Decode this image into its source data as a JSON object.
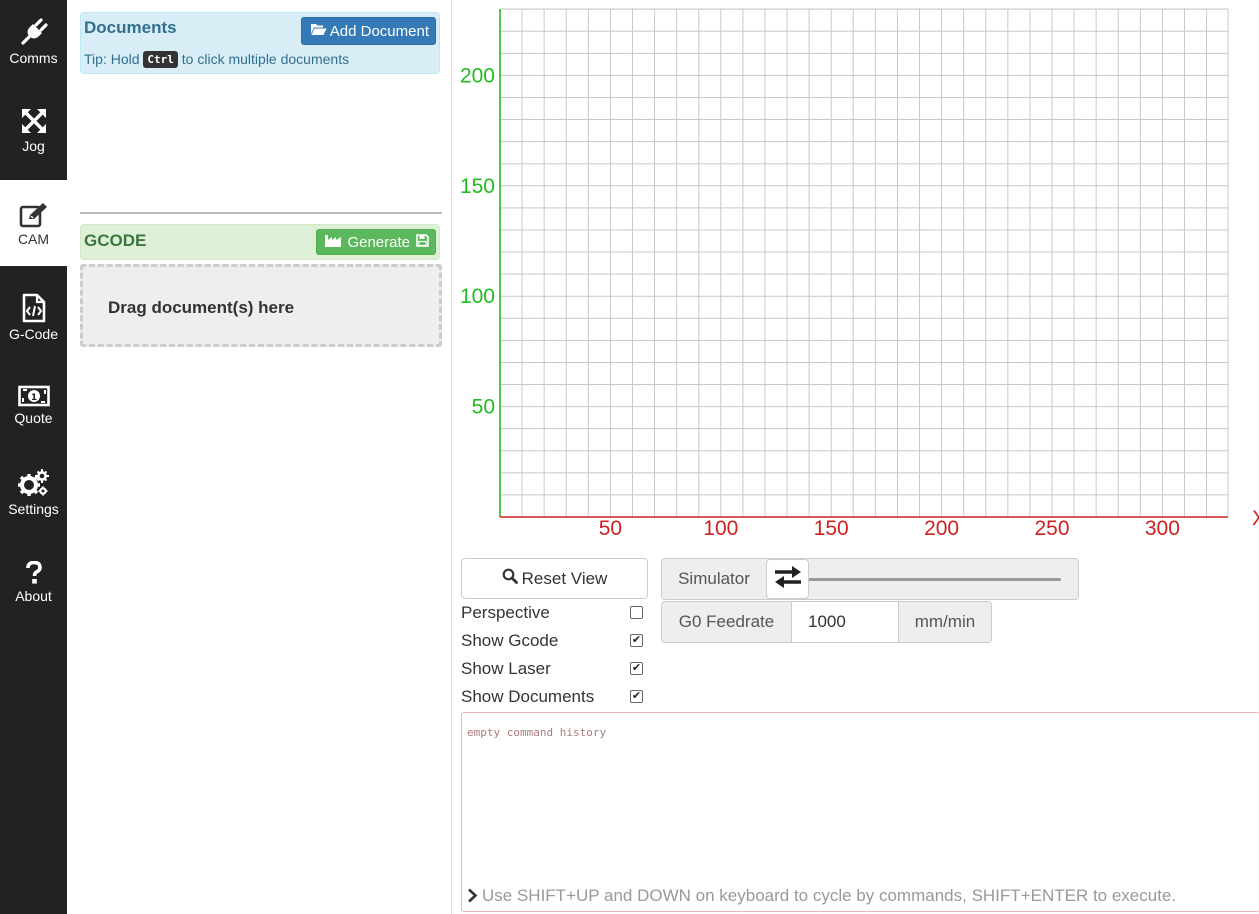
{
  "sidebar": {
    "items": [
      {
        "label": "Comms",
        "icon": "plug-icon"
      },
      {
        "label": "Jog",
        "icon": "arrows-move-icon"
      },
      {
        "label": "CAM",
        "icon": "edit-icon",
        "active": true
      },
      {
        "label": "G-Code",
        "icon": "code-file-icon"
      },
      {
        "label": "Quote",
        "icon": "money-icon"
      },
      {
        "label": "Settings",
        "icon": "gears-icon"
      },
      {
        "label": "About",
        "icon": "question-icon"
      }
    ]
  },
  "documents": {
    "title": "Documents",
    "add_button": "Add Document",
    "tip_prefix": "Tip: Hold",
    "tip_key": "Ctrl",
    "tip_suffix": "to click multiple documents"
  },
  "gcode": {
    "title": "GCODE",
    "generate_button": "Generate",
    "drop_zone": "Drag document(s) here"
  },
  "workspace": {
    "x_axis_color": "#cc2222",
    "y_axis_color": "#22bb22",
    "x_ticks": [
      "50",
      "100",
      "150",
      "200",
      "250",
      "300"
    ],
    "y_ticks": [
      "200",
      "150",
      "100",
      "50"
    ],
    "x_axis_end_label": "X"
  },
  "controls": {
    "reset_view": "Reset View",
    "options": [
      {
        "label": "Perspective",
        "checked": false
      },
      {
        "label": "Show Gcode",
        "checked": true
      },
      {
        "label": "Show Laser",
        "checked": true
      },
      {
        "label": "Show Documents",
        "checked": true
      }
    ],
    "simulator_label": "Simulator",
    "simulator_progress": 0,
    "g0_feedrate_label": "G0 Feedrate",
    "g0_feedrate_value": "1000",
    "g0_feedrate_unit": "mm/min"
  },
  "console": {
    "history_text": "empty command history",
    "input_placeholder": "Use SHIFT+UP and DOWN on keyboard to cycle by commands, SHIFT+ENTER to execute."
  }
}
